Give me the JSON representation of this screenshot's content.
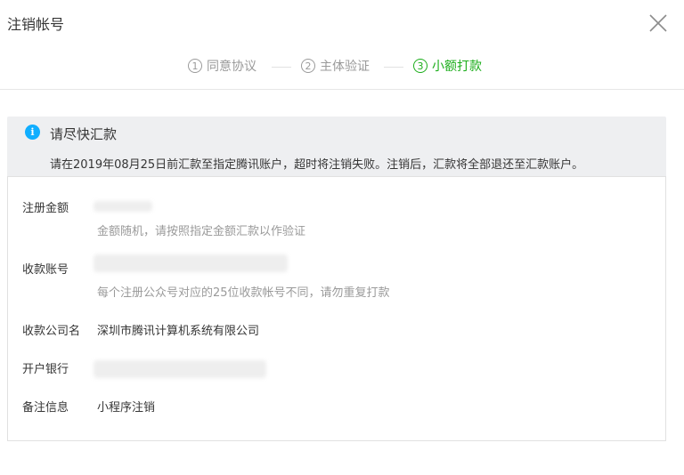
{
  "dialog": {
    "title": "注销帐号",
    "close_icon": "close-icon"
  },
  "steps": [
    {
      "num": "1",
      "label": "同意协议",
      "active": false
    },
    {
      "num": "2",
      "label": "主体验证",
      "active": false
    },
    {
      "num": "3",
      "label": "小额打款",
      "active": true
    }
  ],
  "colors": {
    "accent": "#1aad19",
    "info": "#10aeff",
    "muted": "#9a9a9a",
    "text": "#353535"
  },
  "notice": {
    "icon": "info-icon",
    "heading": "请尽快汇款",
    "message": "请在2019年08月25日前汇款至指定腾讯账户，超时将注销失败。注销后，汇款将全部退还至汇款账户。"
  },
  "details": {
    "amount": {
      "label": "注册金额",
      "tip": "金额随机，请按照指定金额汇款以作验证"
    },
    "account": {
      "label": "收款账号",
      "tip": "每个注册公众号对应的25位收款帐号不同，请勿重复打款"
    },
    "company": {
      "label": "收款公司名",
      "value": "深圳市腾讯计算机系统有限公司"
    },
    "bank": {
      "label": "开户银行"
    },
    "remark": {
      "label": "备注信息",
      "value": "小程序注销"
    }
  }
}
